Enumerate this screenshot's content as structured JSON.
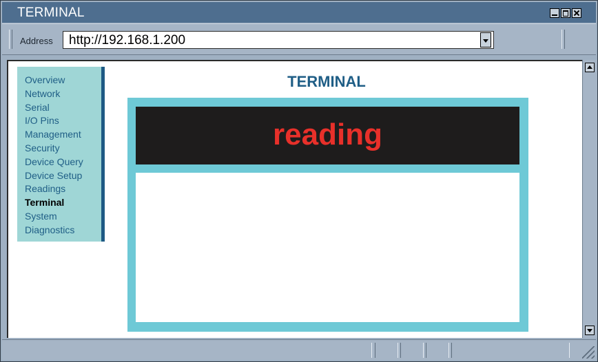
{
  "window": {
    "title": "TERMINAL"
  },
  "address_bar": {
    "label": "Address",
    "value": "http://192.168.1.200"
  },
  "sidebar": {
    "items": [
      {
        "label": "Overview",
        "active": false
      },
      {
        "label": "Network",
        "active": false
      },
      {
        "label": "Serial",
        "active": false
      },
      {
        "label": "I/O Pins",
        "active": false
      },
      {
        "label": "Management",
        "active": false
      },
      {
        "label": "Security",
        "active": false
      },
      {
        "label": "Device Query",
        "active": false
      },
      {
        "label": "Device Setup",
        "active": false
      },
      {
        "label": "Readings",
        "active": false
      },
      {
        "label": "Terminal",
        "active": true
      },
      {
        "label": "System",
        "active": false
      },
      {
        "label": "Diagnostics",
        "active": false
      }
    ]
  },
  "main": {
    "title": "TERMINAL",
    "terminal_header": "reading",
    "terminal_output": ""
  },
  "colors": {
    "titlebar": "#4e6e8f",
    "sidebar_bg": "#9fd6d6",
    "link": "#1f5e86",
    "terminal_frame": "#6ec9d6",
    "terminal_header_bg": "#1e1c1c",
    "terminal_header_text": "#e8302a"
  },
  "icons": {
    "minimize": "minimize-icon",
    "maximize": "maximize-icon",
    "close": "close-icon",
    "dropdown": "chevron-down-icon",
    "scroll_up": "arrow-up-icon",
    "scroll_down": "arrow-down-icon",
    "resize": "resize-grip-icon"
  }
}
